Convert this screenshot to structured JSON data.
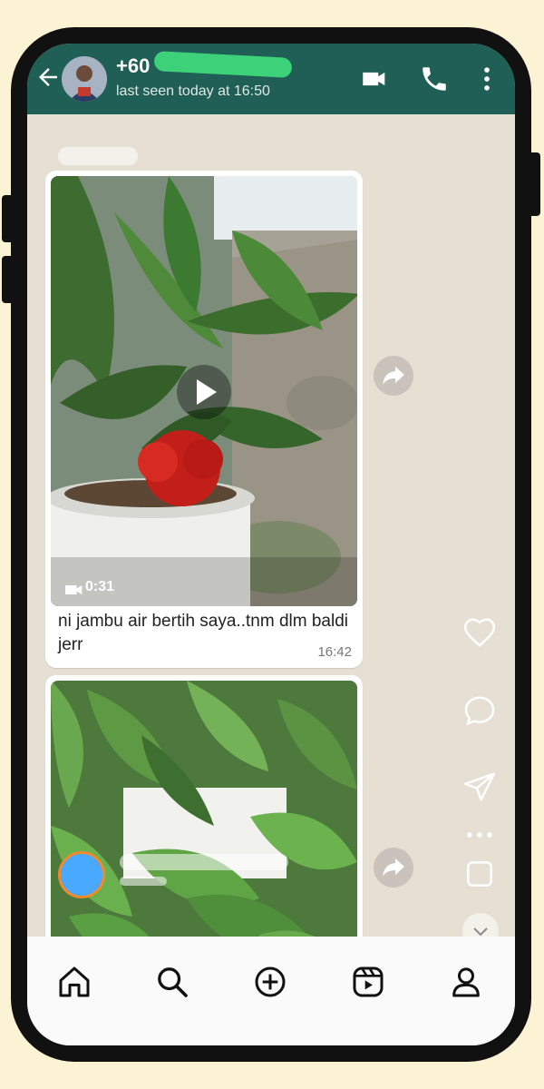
{
  "header": {
    "contact_name": "+60",
    "last_seen": "last seen today at 16:50"
  },
  "messages": [
    {
      "type": "video",
      "duration": "0:31",
      "caption": "ni jambu air bertih saya..tnm dlm baldi jerr",
      "time": "16:42"
    },
    {
      "type": "video",
      "duration": "",
      "caption": "",
      "time": ""
    }
  ],
  "icons": {
    "back": "back-arrow-icon",
    "video_call": "video-call-icon",
    "voice_call": "phone-icon",
    "menu": "more-vert-icon",
    "play": "play-icon",
    "forward": "forward-icon",
    "like": "heart-icon",
    "comment": "comment-icon",
    "share": "send-icon",
    "more": "more-horiz-icon",
    "save": "save-icon",
    "nav_home": "home-icon",
    "nav_search": "search-icon",
    "nav_create": "plus-square-icon",
    "nav_reels": "reels-icon",
    "nav_profile": "profile-icon"
  },
  "colors": {
    "header": "#1f5f56",
    "background": "#fbf3d3",
    "accent_scribble": "#3fd77b"
  }
}
